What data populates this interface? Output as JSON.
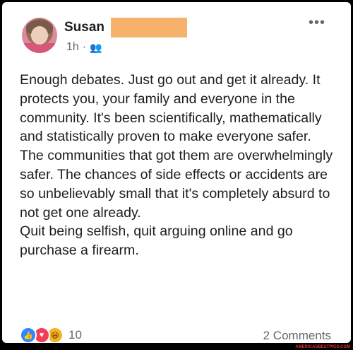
{
  "post": {
    "author_name": "Susan",
    "time": "1h",
    "separator": "·",
    "audience_icon": "friends-icon",
    "more_label": "•••",
    "paragraphs": [
      "Enough debates. Just go out and get it already. It protects you, your family and everyone in the community. It's been scientifically, mathematically and statistically proven to make everyone safer. The communities that got them are overwhelmingly safer. The chances of side effects or accidents are so unbelievably small that it's completely absurd to not get one already.",
      "Quit being selfish, quit arguing online and go purchase a firearm."
    ],
    "reactions": {
      "icons": [
        "like-icon",
        "love-icon",
        "haha-icon"
      ],
      "count": "10"
    },
    "comments_label": "2 Comments"
  },
  "watermark": "AMERICASBESTPICS.COM",
  "colors": {
    "redaction": "#f6b26b",
    "text": "#1c1e21",
    "muted": "#606770",
    "like": "#2d88ff",
    "love": "#f33e58",
    "haha": "#f7b125"
  }
}
